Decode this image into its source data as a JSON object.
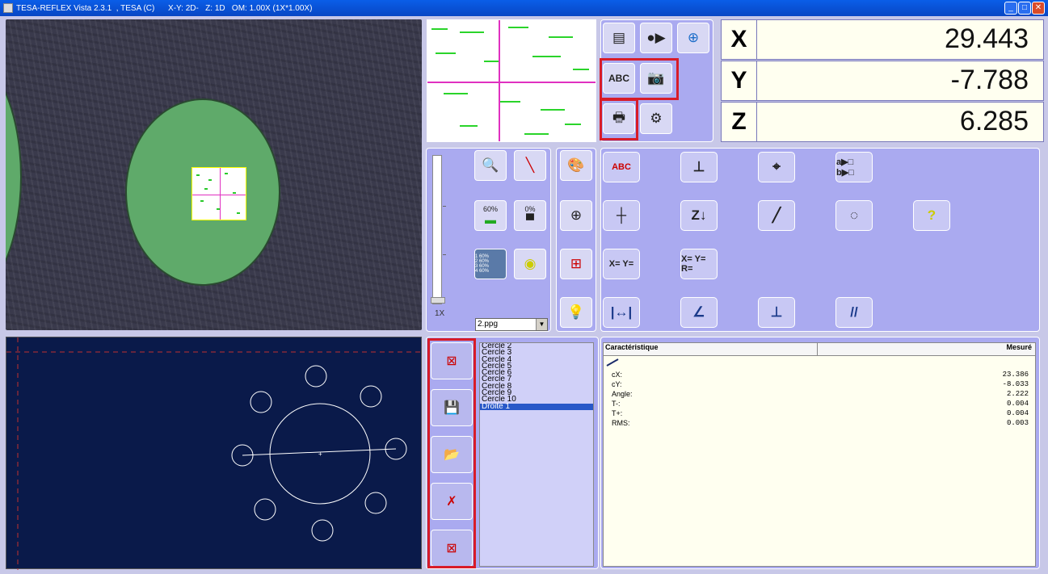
{
  "titlebar": {
    "title": "TESA-REFLEX Vista 2.3.1  , TESA (C)      X-Y: 2D-   Z: 1D   OM: 1.00X (1X*1.00X)"
  },
  "coords": [
    {
      "axis": "X",
      "value": "29.443"
    },
    {
      "axis": "Y",
      "value": "-7.788"
    },
    {
      "axis": "Z",
      "value": "6.285"
    }
  ],
  "lighting": {
    "top_pct": "60%",
    "bottom_pct": "0%",
    "rings": [
      "1 60%",
      "2 60%",
      "3 60%",
      "4 60%"
    ],
    "zoom_label": "1X",
    "program_file": "2.ppg"
  },
  "features": [
    "Cercle 2",
    "Cercle 3",
    "Cercle 4",
    "Cercle 5",
    "Cercle 6",
    "Cercle 7",
    "Cercle 8",
    "Cercle 9",
    "Cercle 10",
    "Droite 1"
  ],
  "selected_feature": "Droite 1",
  "results": {
    "col_char": "Caractéristique",
    "col_measured": "Mesuré",
    "rows": [
      {
        "k": "cX:",
        "v": "23.386"
      },
      {
        "k": "cY:",
        "v": "-8.033"
      },
      {
        "k": "Angle:",
        "v": "2.222"
      },
      {
        "k": "T-:",
        "v": "0.004"
      },
      {
        "k": "T+:",
        "v": "0.004"
      },
      {
        "k": "RMS:",
        "v": "0.003"
      }
    ]
  },
  "toolbar_text": {
    "abc": "ABC",
    "abc_grid": "ABC",
    "seq": "a▶□ b▶□",
    "xy": "X= Y=",
    "xyr": "X= Y= R=",
    "z": "Z"
  },
  "colors": {
    "accent_red": "#d81c28",
    "panel": "#aaaaf0",
    "graph_bg": "#0a1a4a"
  },
  "window_buttons": [
    "minimize",
    "maximize",
    "close"
  ]
}
